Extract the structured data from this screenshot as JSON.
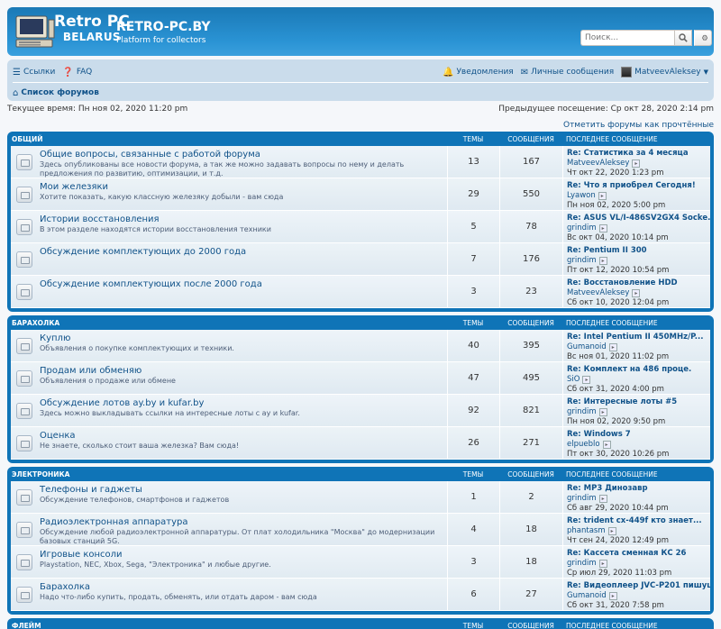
{
  "header": {
    "logo_line1": "Retro PC",
    "logo_line2": "BELARUS",
    "site_name": "RETRO-PC.BY",
    "site_desc": "Platform for collectors",
    "search_placeholder": "Поиск..."
  },
  "nav": {
    "links_label": "Ссылки",
    "faq_label": "FAQ",
    "notifications_label": "Уведомления",
    "messages_label": "Личные сообщения",
    "user_label": "MatveevAleksey",
    "breadcrumb": "Список форумов"
  },
  "status": {
    "current_time": "Текущее время: Пн ноя 02, 2020 11:20 pm",
    "last_visit": "Предыдущее посещение: Ср окт 28, 2020 2:14 pm",
    "mark_read": "Отметить форумы как прочтённые"
  },
  "columns": {
    "topics": "Темы",
    "posts": "Сообщения",
    "last": "Последнее сообщение"
  },
  "categories": [
    {
      "name": "Общий",
      "forums": [
        {
          "title": "Общие вопросы, связанные с работой форума",
          "desc": "Здесь опубликованы все новости форума, а так же можно задавать вопросы по нему и делать предложения по развитию, оптимизации, и т.д.",
          "topics": "13",
          "posts": "167",
          "last_title": "Re: Статистика за 4 месяца",
          "last_author": "MatveevAleksey",
          "last_date": "Чт окт 22, 2020 1:23 pm"
        },
        {
          "title": "Мои железяки",
          "desc": "Хотите показать, какую классную железяку добыли - вам сюда",
          "topics": "29",
          "posts": "550",
          "last_title": "Re: Что я приобрел Сегодня!",
          "last_author": "Lyawon",
          "last_date": "Пн ноя 02, 2020 5:00 pm"
        },
        {
          "title": "Истории восстановления",
          "desc": "В этом разделе находятся истории восстановления техники",
          "topics": "5",
          "posts": "78",
          "last_title": "Re: ASUS VL/I-486SV2GX4 Socke...",
          "last_author": "grindim",
          "last_date": "Вс окт 04, 2020 10:14 pm"
        },
        {
          "title": "Обсуждение комплектующих до 2000 года",
          "desc": "",
          "topics": "7",
          "posts": "176",
          "last_title": "Re: Pentium II 300",
          "last_author": "grindim",
          "last_date": "Пт окт 12, 2020 10:54 pm"
        },
        {
          "title": "Обсуждение комплектующих после 2000 года",
          "desc": "",
          "topics": "3",
          "posts": "23",
          "last_title": "Re: Восстановление HDD",
          "last_author": "MatveevAleksey",
          "last_date": "Сб окт 10, 2020 12:04 pm"
        }
      ]
    },
    {
      "name": "Барахолка",
      "forums": [
        {
          "title": "Куплю",
          "desc": "Объявления о покупке комплектующих и техники.",
          "topics": "40",
          "posts": "395",
          "last_title": "Re: Intel Pentium II 450MHz/P...",
          "last_author": "Gumanoid",
          "last_date": "Вс ноя 01, 2020 11:02 pm"
        },
        {
          "title": "Продам или обменяю",
          "desc": "Объявления о продаже или обмене",
          "topics": "47",
          "posts": "495",
          "last_title": "Re: Комплект на 486 проце.",
          "last_author": "SiO",
          "last_date": "Сб окт 31, 2020 4:00 pm"
        },
        {
          "title": "Обсуждение лотов ay.by и kufar.by",
          "desc": "Здесь можно выкладывать ссылки на интересные лоты с ay и kufar.",
          "topics": "92",
          "posts": "821",
          "last_title": "Re: Интересные лоты #5",
          "last_author": "grindim",
          "last_date": "Пн ноя 02, 2020 9:50 pm"
        },
        {
          "title": "Оценка",
          "desc": "Не знаете, сколько стоит ваша железка? Вам сюда!",
          "topics": "26",
          "posts": "271",
          "last_title": "Re: Windows 7",
          "last_author": "elpueblo",
          "last_date": "Пт окт 30, 2020 10:26 pm"
        }
      ]
    },
    {
      "name": "Электроника",
      "forums": [
        {
          "title": "Телефоны и гаджеты",
          "desc": "Обсуждение телефонов, смартфонов и гаджетов",
          "topics": "1",
          "posts": "2",
          "last_title": "Re: MP3 Динозавр",
          "last_author": "grindim",
          "last_date": "Сб авг 29, 2020 10:44 pm"
        },
        {
          "title": "Радиоэлектронная аппаратура",
          "desc": "Обсуждение любой радиоэлектронной аппаратуры. От плат холодильника \"Москва\" до модернизации базовых станций 5G.",
          "topics": "4",
          "posts": "18",
          "last_title": "Re: trident cx-449f кто знает...",
          "last_author": "phantasm",
          "last_date": "Чт сен 24, 2020 12:49 pm"
        },
        {
          "title": "Игровые консоли",
          "desc": "Playstation, NEC, Xbox, Sega, \"Электроника\" и любые другие.",
          "topics": "3",
          "posts": "18",
          "last_title": "Re: Кассета сменная КС 26",
          "last_author": "grindim",
          "last_date": "Ср июл 29, 2020 11:03 pm"
        },
        {
          "title": "Барахолка",
          "desc": "Надо что-либо купить, продать, обменять, или отдать даром - вам сюда",
          "topics": "6",
          "posts": "27",
          "last_title": "Re: Видеоплеер JVC-P201 пишущ...",
          "last_author": "Gumanoid",
          "last_date": "Сб окт 31, 2020 7:58 pm"
        }
      ]
    },
    {
      "name": "Флейм",
      "forums": []
    }
  ]
}
